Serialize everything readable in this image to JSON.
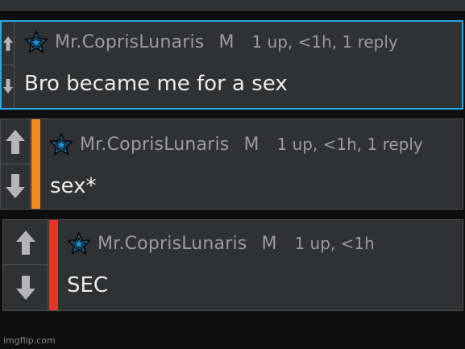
{
  "comments": [
    {
      "username": "Mr.CoprisLunaris",
      "gender": "M",
      "meta": "1 up, <1h, 1 reply",
      "text": "Bro became me for a sex",
      "accent": "#29a9e0"
    },
    {
      "username": "Mr.CoprisLunaris",
      "gender": "M",
      "meta": "1 up, <1h, 1 reply",
      "text": "sex*",
      "accent": "#f08a1a"
    },
    {
      "username": "Mr.CoprisLunaris",
      "gender": "M",
      "meta": "1 up, <1h",
      "text": "SEC",
      "accent": "#e8322a"
    }
  ],
  "icons": {
    "badge": "star-icon",
    "upvote": "up-arrow-icon",
    "downvote": "down-arrow-icon"
  },
  "colors": {
    "badge_star": "#1c8fd6",
    "arrow": "#b5b5b7"
  },
  "watermark": "imgflip.com"
}
